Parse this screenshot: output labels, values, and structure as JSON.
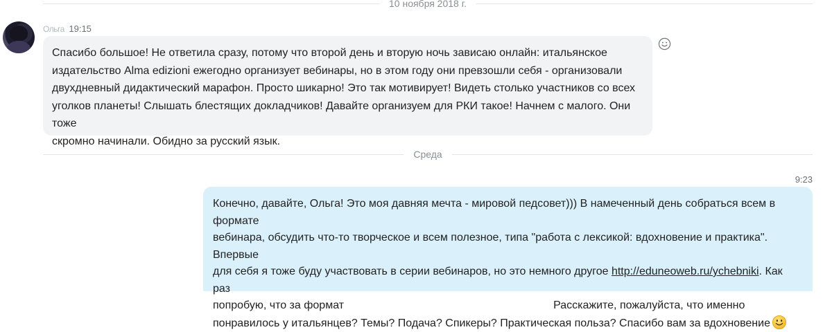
{
  "dividers": {
    "top_date": "10 ноября 2018 г.",
    "wednesday": "Среда"
  },
  "incoming": {
    "sender_name": "Ольга",
    "time": "19:15",
    "lines": [
      "Спасибо большое! Не ответила сразу, потому что второй день и вторую ночь зависаю онлайн: итальянское",
      "издательство Alma edizioni ежегодно организует вебинары, но в этом году они превзошли себя - организовали",
      "двухдневный дидактический марафон. Просто шикарно! Это так мотивирует! Видеть столько участников со всех",
      "уголков планеты! Слышать блестящих докладчиков! Давайте организуем для РКИ такое! Начнем с малого. Они тоже",
      "скромно начинали. Обидно за русский язык."
    ],
    "reaction_icon": "smiley-reaction-icon"
  },
  "outgoing": {
    "time": "9:23",
    "line1": "Конечно, давайте, Ольга! Это моя давняя мечта - мировой педсовет))) В намеченный день собраться всем в формате",
    "line2": "вебинара, обсудить что-то творческое и всем полезное, типа \"работа с лексикой: вдохновение и практика\". Впервые",
    "line3_before": "для себя я тоже буду участвовать в серии вебинаров, но это немного другое ",
    "line3_link": "http://eduneoweb.ru/ychebniki",
    "line3_after": ". Как раз",
    "line4_before": "попробую, что за формат",
    "line4_after": "Расскажите, пожалуйста, что именно",
    "line5": "понравилось у итальянцев? Темы? Подача? Спикеры? Практическая польза? Спасибо вам за вдохновение",
    "emoji_icon": "smiley-emoji-icon"
  },
  "colors": {
    "incoming_bubble": "#f1f3f5",
    "outgoing_bubble": "#daf1fc",
    "divider_text": "#8a8f94",
    "emoji_yellow": "#f7c940"
  }
}
